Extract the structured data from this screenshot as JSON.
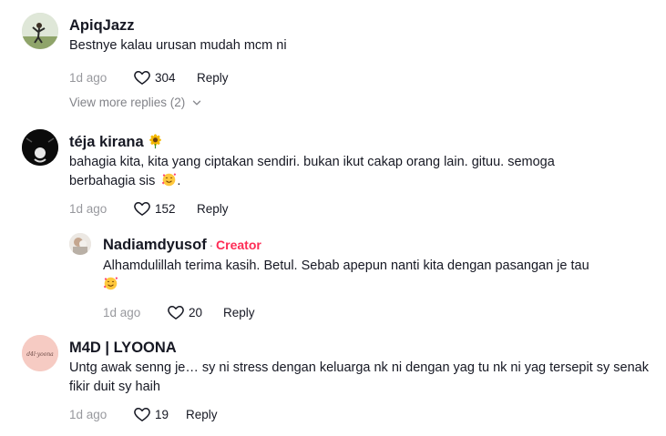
{
  "comments": [
    {
      "username": "ApiqJazz",
      "text": "Bestnye kalau urusan mudah mcm ni",
      "time": "1d ago",
      "likes": "304",
      "reply": "Reply",
      "view_more": "View more replies (2)"
    },
    {
      "username": "téja kirana",
      "username_emoji": "sunflower-emoji",
      "text": "bahagia kita, kita yang ciptakan sendiri. bukan ikut cakap orang lain. gituu. semoga berbahagia sis",
      "text_suffix": ".",
      "time": "1d ago",
      "likes": "152",
      "reply": "Reply"
    },
    {
      "username": "Nadiamdyusof",
      "separator": "·",
      "badge": "Creator",
      "text": "Alhamdulillah terima kasih. Betul. Sebab apepun nanti kita dengan pasangan je tau",
      "time": "1d ago",
      "likes": "20",
      "reply": "Reply"
    },
    {
      "username": "M4D | LYOONA",
      "avatar_text": "d4l·yoona",
      "text": "Untg awak senng je… sy ni stress dengan keluarga nk ni dengan yag tu nk ni yag tersepit sy senak fikir duit sy haih",
      "time": "1d ago",
      "likes": "19",
      "reply": "Reply"
    }
  ],
  "colors": {
    "accent": "#fe2c55",
    "text": "#161823",
    "muted": "#8a8b91"
  }
}
